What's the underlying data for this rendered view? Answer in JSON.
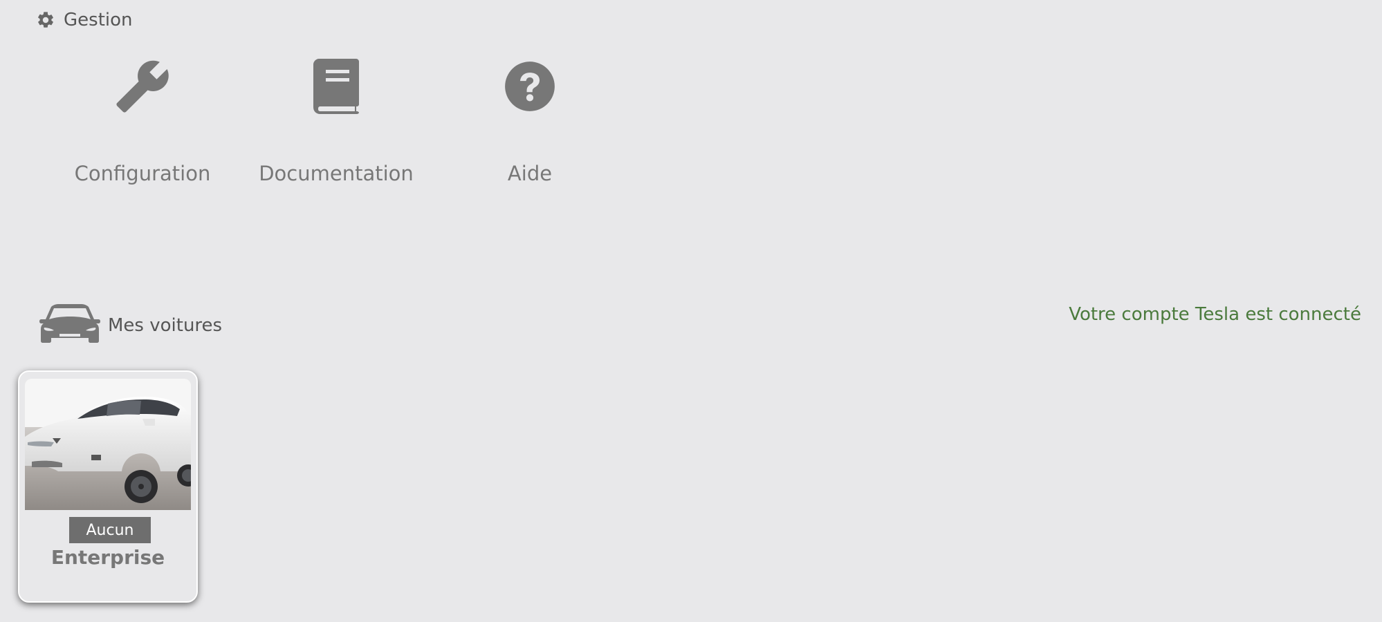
{
  "gestion": {
    "title": "Gestion",
    "icon": "gear-icon",
    "tiles": [
      {
        "label": "Configuration",
        "icon": "wrench-icon"
      },
      {
        "label": "Documentation",
        "icon": "book-icon"
      },
      {
        "label": "Aide",
        "icon": "question-circle-icon"
      }
    ]
  },
  "cars": {
    "title": "Mes voitures",
    "icon": "car-icon",
    "status": "Votre compte Tesla est connecté",
    "items": [
      {
        "status_badge": "Aucun",
        "name": "Enterprise"
      }
    ]
  },
  "colors": {
    "background": "#e8e8ea",
    "icon": "#777777",
    "connected_status": "#4a7a3c",
    "badge_bg": "#6e6e6e"
  }
}
